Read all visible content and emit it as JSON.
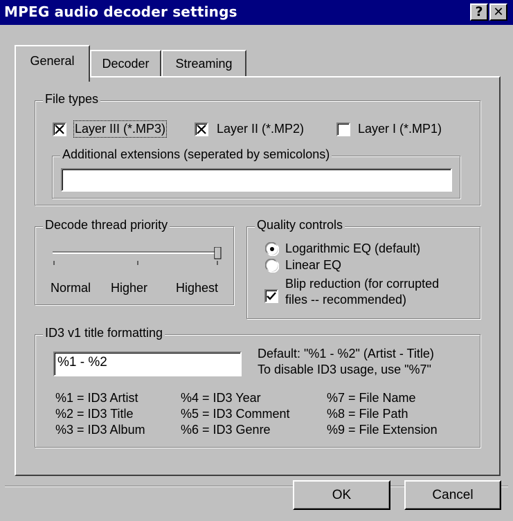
{
  "window": {
    "title": "MPEG audio decoder settings",
    "help_glyph": "?",
    "close_glyph": "✕"
  },
  "tabs": [
    "General",
    "Decoder",
    "Streaming"
  ],
  "file_types": {
    "legend": "File types",
    "options": [
      {
        "label": "Layer III (*.MP3)",
        "checked": true
      },
      {
        "label": "Layer II (*.MP2)",
        "checked": true
      },
      {
        "label": "Layer I (*.MP1)",
        "checked": false
      }
    ],
    "additional_ext_legend": "Additional extensions (seperated by semicolons)",
    "additional_ext_value": ""
  },
  "priority": {
    "legend": "Decode thread priority",
    "labels": [
      "Normal",
      "Higher",
      "Highest"
    ],
    "selected": "Highest"
  },
  "quality": {
    "legend": "Quality controls",
    "eq_options": [
      {
        "label": "Logarithmic EQ (default)",
        "selected": true
      },
      {
        "label": "Linear EQ",
        "selected": false
      }
    ],
    "blip_line1": "Blip reduction (for corrupted",
    "blip_line2": "files -- recommended)",
    "blip_checked": true
  },
  "id3": {
    "legend": "ID3 v1 title formatting",
    "format_value": "%1 - %2",
    "default_line": "Default: \"%1 - %2\"  (Artist - Title)",
    "disable_line": "To disable ID3 usage, use \"%7\"",
    "legend_items": [
      [
        "%1 = ID3 Artist",
        "%4 = ID3 Year",
        "%7 = File Name"
      ],
      [
        "%2 = ID3 Title",
        "%5 = ID3 Comment",
        "%8 = File Path"
      ],
      [
        "%3 = ID3 Album",
        "%6 = ID3 Genre",
        "%9 = File Extension"
      ]
    ]
  },
  "buttons": {
    "ok": "OK",
    "cancel": "Cancel"
  }
}
